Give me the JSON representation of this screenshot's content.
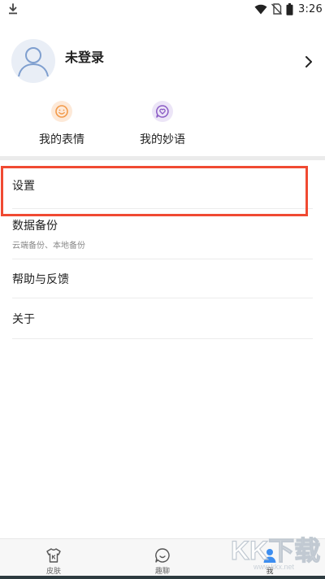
{
  "status_bar": {
    "time": "3:26",
    "icons": [
      "download-icon",
      "wifi-icon",
      "no-sim-icon",
      "battery-icon"
    ]
  },
  "profile": {
    "name": "未登录",
    "avatar_icon": "user-avatar-icon",
    "chevron_icon": "chevron-right-icon"
  },
  "quick_actions": [
    {
      "label": "我的表情",
      "icon": "smiley-icon",
      "color": "#f29a4a"
    },
    {
      "label": "我的妙语",
      "icon": "heart-chat-icon",
      "color": "#8b5cc5"
    }
  ],
  "menu": [
    {
      "title": "设置"
    },
    {
      "title": "数据备份",
      "subtitle": "云端备份、本地备份"
    },
    {
      "title": "帮助与反馈"
    },
    {
      "title": "关于"
    }
  ],
  "highlight": {
    "target": "设置",
    "color": "#f04a32"
  },
  "bottom_nav": [
    {
      "label": "皮肤",
      "icon": "tshirt-icon"
    },
    {
      "label": "趣聊",
      "icon": "chat-bubble-icon"
    },
    {
      "label": "我",
      "icon": "person-icon",
      "active": true,
      "active_color": "#3d8ef0"
    }
  ],
  "watermark": {
    "text": "KK下载",
    "subtext": "www.kkx.net"
  }
}
